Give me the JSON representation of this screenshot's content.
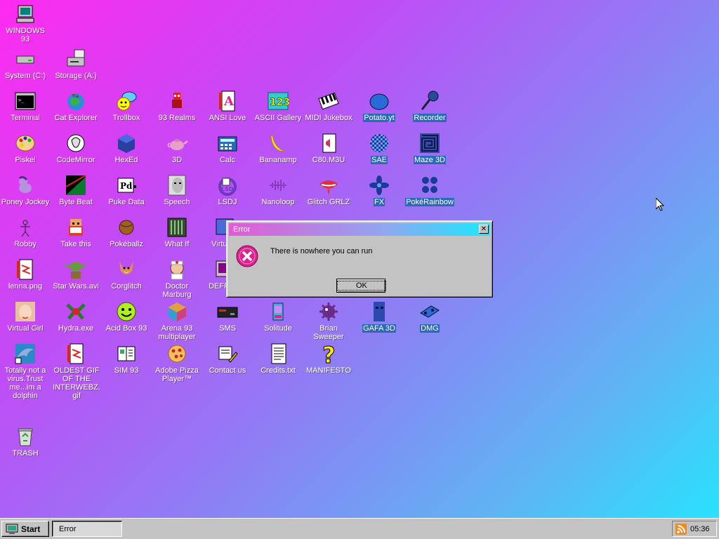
{
  "desktop": {
    "icons": [
      {
        "id": "windows93",
        "label": "WINDOWS 93",
        "icon": "computer-icon"
      },
      {
        "id": "system",
        "label": "System (C:)",
        "icon": "hard-drive-icon"
      },
      {
        "id": "storage",
        "label": "Storage (A:)",
        "icon": "floppy-drive-icon"
      },
      {
        "id": "terminal",
        "label": "Terminal",
        "icon": "terminal-icon"
      },
      {
        "id": "cat-explorer",
        "label": "Cat Explorer",
        "icon": "cat-globe-icon"
      },
      {
        "id": "trollbox",
        "label": "Trollbox",
        "icon": "chat-face-icon"
      },
      {
        "id": "93realms",
        "label": "93 Realms",
        "icon": "realms-icon"
      },
      {
        "id": "ansi-love",
        "label": "ANSI Love",
        "icon": "ansi-letter-icon"
      },
      {
        "id": "ascii-gallery",
        "label": "ASCII Gallery",
        "icon": "numbers-icon"
      },
      {
        "id": "midi-jukebox",
        "label": "MIDI Jukebox",
        "icon": "piano-icon"
      },
      {
        "id": "potato",
        "label": "Potato.yt",
        "icon": "potato-icon"
      },
      {
        "id": "recorder",
        "label": "Recorder",
        "icon": "microphone-icon"
      },
      {
        "id": "piskel",
        "label": "Piskel",
        "icon": "palette-icon"
      },
      {
        "id": "codemirror",
        "label": "CodeMirror",
        "icon": "codemirror-icon"
      },
      {
        "id": "hexed",
        "label": "HexEd",
        "icon": "cube-icon"
      },
      {
        "id": "3d",
        "label": "3D",
        "icon": "teapot-icon"
      },
      {
        "id": "calc",
        "label": "Calc",
        "icon": "calculator-icon"
      },
      {
        "id": "bananamp",
        "label": "Bananamp",
        "icon": "banana-icon"
      },
      {
        "id": "c80m3u",
        "label": "C80.M3U",
        "icon": "playlist-file-icon"
      },
      {
        "id": "sae",
        "label": "SAE",
        "icon": "checker-ball-icon"
      },
      {
        "id": "maze3d",
        "label": "Maze 3D",
        "icon": "maze-icon"
      },
      {
        "id": "poney-jockey",
        "label": "Poney Jockey",
        "icon": "pony-icon"
      },
      {
        "id": "byte-beat",
        "label": "Byte Beat",
        "icon": "bytebeat-icon"
      },
      {
        "id": "puke-data",
        "label": "Puke Data",
        "icon": "pd-icon"
      },
      {
        "id": "speech",
        "label": "Speech",
        "icon": "speech-face-icon"
      },
      {
        "id": "lsdj",
        "label": "LSDJ",
        "icon": "lsdj-icon"
      },
      {
        "id": "nanoloop",
        "label": "Nanoloop",
        "icon": "waveform-icon"
      },
      {
        "id": "glitch-grlz",
        "label": "Glitch GRLZ",
        "icon": "lips-icon"
      },
      {
        "id": "fx",
        "label": "FX",
        "icon": "fx-icon"
      },
      {
        "id": "pokerainbow",
        "label": "PokéRainbow",
        "icon": "pokerainbow-icon"
      },
      {
        "id": "robby",
        "label": "Robby",
        "icon": "stick-figure-icon"
      },
      {
        "id": "take-this",
        "label": "Take this",
        "icon": "old-man-icon"
      },
      {
        "id": "pokeballz",
        "label": "Pokéballz",
        "icon": "ball-icon"
      },
      {
        "id": "what-if",
        "label": "What If",
        "icon": "whatif-icon"
      },
      {
        "id": "virtual",
        "label": "Virtua...",
        "icon": "virtual-icon"
      },
      {
        "id": "lenna",
        "label": "lenna.png",
        "icon": "image-file-icon"
      },
      {
        "id": "star-wars",
        "label": "Star Wars.avi",
        "icon": "yoda-icon"
      },
      {
        "id": "corglitch",
        "label": "Corglitch",
        "icon": "corgi-icon"
      },
      {
        "id": "doctor-marburg",
        "label": "Doctor Marburg",
        "icon": "doctor-icon"
      },
      {
        "id": "defrag",
        "label": "DEFRAG",
        "icon": "defrag-icon"
      },
      {
        "id": "virtual-girl",
        "label": "Virtual Girl",
        "icon": "girl-face-icon"
      },
      {
        "id": "hydra",
        "label": "Hydra.exe",
        "icon": "hydra-icon"
      },
      {
        "id": "acid-box",
        "label": "Acid Box 93",
        "icon": "smiley-icon"
      },
      {
        "id": "arena93",
        "label": "Arena 93 multiplayer",
        "icon": "arena-cube-icon"
      },
      {
        "id": "sms",
        "label": "SMS",
        "icon": "sms-console-icon"
      },
      {
        "id": "solitude",
        "label": "Solitude",
        "icon": "solitude-icon"
      },
      {
        "id": "brian-sweeper",
        "label": "Brian Sweeper",
        "icon": "mine-icon"
      },
      {
        "id": "gafa3d",
        "label": "GAFA 3D",
        "icon": "gafa-face-icon"
      },
      {
        "id": "dmg",
        "label": "DMG",
        "icon": "dmg-icon"
      },
      {
        "id": "dolphin",
        "label": "Totally not a virus.Trust me...im a dolphin",
        "icon": "dolphin-icon"
      },
      {
        "id": "oldest-gif",
        "label": "OLDEST GIF OF THE INTERWEBZ.gif",
        "icon": "gif-file-icon"
      },
      {
        "id": "sim93",
        "label": "SIM 93",
        "icon": "sim-book-icon"
      },
      {
        "id": "adobe-pizza",
        "label": "Adobe Pizza Player™",
        "icon": "pizza-icon"
      },
      {
        "id": "contact",
        "label": "Contact us",
        "icon": "contact-icon"
      },
      {
        "id": "credits",
        "label": "Credits.txt",
        "icon": "text-file-icon"
      },
      {
        "id": "manifesto",
        "label": "MANIFESTO",
        "icon": "question-mark-icon"
      },
      {
        "id": "trash",
        "label": "TRASH",
        "icon": "recycle-bin-icon"
      }
    ]
  },
  "dialog": {
    "title": "Error",
    "close_label": "✕",
    "message": "There is nowhere you can run",
    "ok_label": "OK"
  },
  "taskbar": {
    "start_label": "Start",
    "task_label": "Error",
    "clock": "05:36"
  },
  "colors": {
    "selection": "#2a6ab8",
    "window_face": "#c3c3c3",
    "error_icon": "#e0208f"
  }
}
